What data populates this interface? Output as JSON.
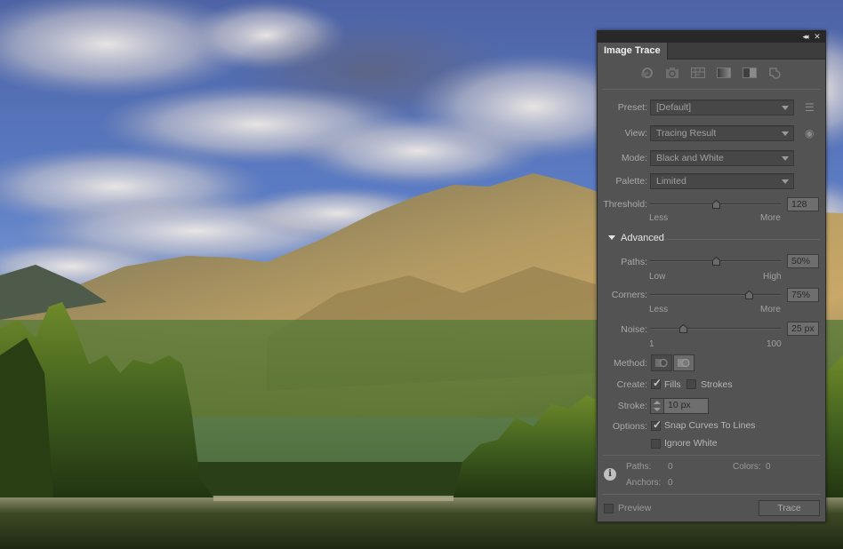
{
  "panel": {
    "title": "Image Trace",
    "titlebar": {
      "collapse_icon": "◂◂",
      "close_icon": "✕"
    },
    "preset_icons": [
      {
        "name": "auto-color-icon",
        "tooltip": "Auto-Color"
      },
      {
        "name": "high-color-icon",
        "tooltip": "High Color"
      },
      {
        "name": "low-color-icon",
        "tooltip": "Low Color"
      },
      {
        "name": "grayscale-icon",
        "tooltip": "Grayscale"
      },
      {
        "name": "black-and-white-icon",
        "tooltip": "Black and White"
      },
      {
        "name": "outline-icon",
        "tooltip": "Outline"
      }
    ],
    "preset": {
      "label": "Preset:",
      "value": "[Default]",
      "side_icon": "☰"
    },
    "view": {
      "label": "View:",
      "value": "Tracing Result",
      "side_icon": "◉"
    },
    "mode": {
      "label": "Mode:",
      "value": "Black and White"
    },
    "palette": {
      "label": "Palette:",
      "value": "Limited"
    },
    "threshold": {
      "label": "Threshold:",
      "value": "128",
      "fraction": 0.5,
      "min_label": "Less",
      "max_label": "More"
    },
    "advanced": {
      "label": "Advanced",
      "paths": {
        "label": "Paths:",
        "value": "50%",
        "fraction": 0.5,
        "min_label": "Low",
        "max_label": "High"
      },
      "corners": {
        "label": "Corners:",
        "value": "75%",
        "fraction": 0.75,
        "min_label": "Less",
        "max_label": "More"
      },
      "noise": {
        "label": "Noise:",
        "value": "25 px",
        "fraction": 0.25,
        "min_label": "1",
        "max_label": "100"
      },
      "method": {
        "label": "Method:",
        "options": [
          "Abutting",
          "Overlapping"
        ],
        "selected": "Overlapping"
      },
      "create": {
        "label": "Create:",
        "fills_label": "Fills",
        "fills_checked": true,
        "strokes_label": "Strokes",
        "strokes_checked": false
      },
      "stroke": {
        "label": "Stroke:",
        "value": "10 px"
      },
      "options": {
        "label": "Options:",
        "snap_label": "Snap Curves To Lines",
        "snap_checked": true,
        "ignore_white_label": "Ignore White",
        "ignore_white_checked": false
      }
    },
    "info": {
      "paths_label": "Paths:",
      "paths_value": "0",
      "colors_label": "Colors:",
      "colors_value": "0",
      "anchors_label": "Anchors:",
      "anchors_value": "0"
    },
    "preview": {
      "label": "Preview",
      "checked": false
    },
    "trace_button": "Trace"
  },
  "colors": {
    "panel_bg": "#535353",
    "titlebar_bg": "#282828",
    "tabbar_bg": "#3c3c3c"
  }
}
